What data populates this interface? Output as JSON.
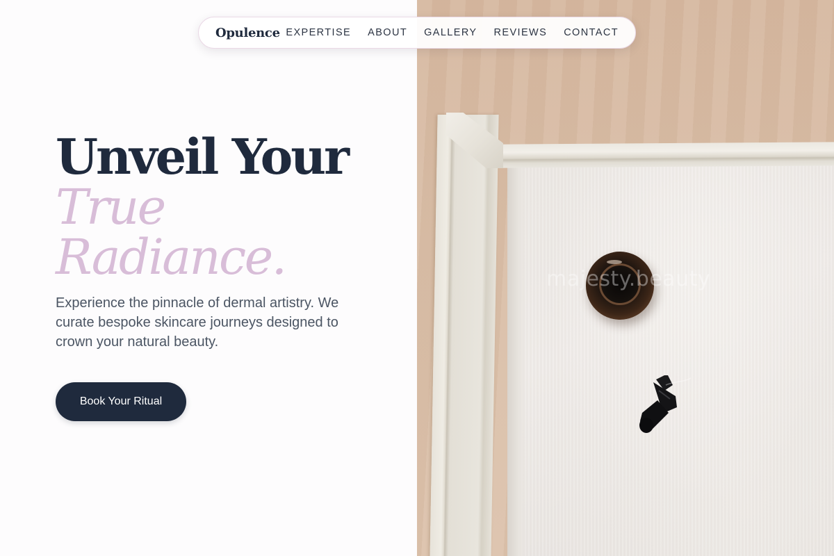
{
  "brand": {
    "name": "Opulence"
  },
  "nav": {
    "items": [
      {
        "label": "EXPERTISE"
      },
      {
        "label": "ABOUT"
      },
      {
        "label": "GALLERY"
      },
      {
        "label": "REVIEWS"
      },
      {
        "label": "CONTACT"
      }
    ]
  },
  "hero": {
    "headline_line1": "Unveil Your",
    "headline_accent_line1": "True",
    "headline_accent_line2": "Radiance.",
    "description": "Experience the pinnacle of dermal artistry. We curate bespoke skincare journeys designed to crown your natural beauty.",
    "cta_label": "Book Your Ritual"
  },
  "image": {
    "watermark": "majesty.beauty"
  },
  "colors": {
    "navy": "#1f2a3d",
    "accent_lilac": "#d8bdd8",
    "body_text": "#4b5563",
    "page_bg": "#fdfcfd"
  }
}
